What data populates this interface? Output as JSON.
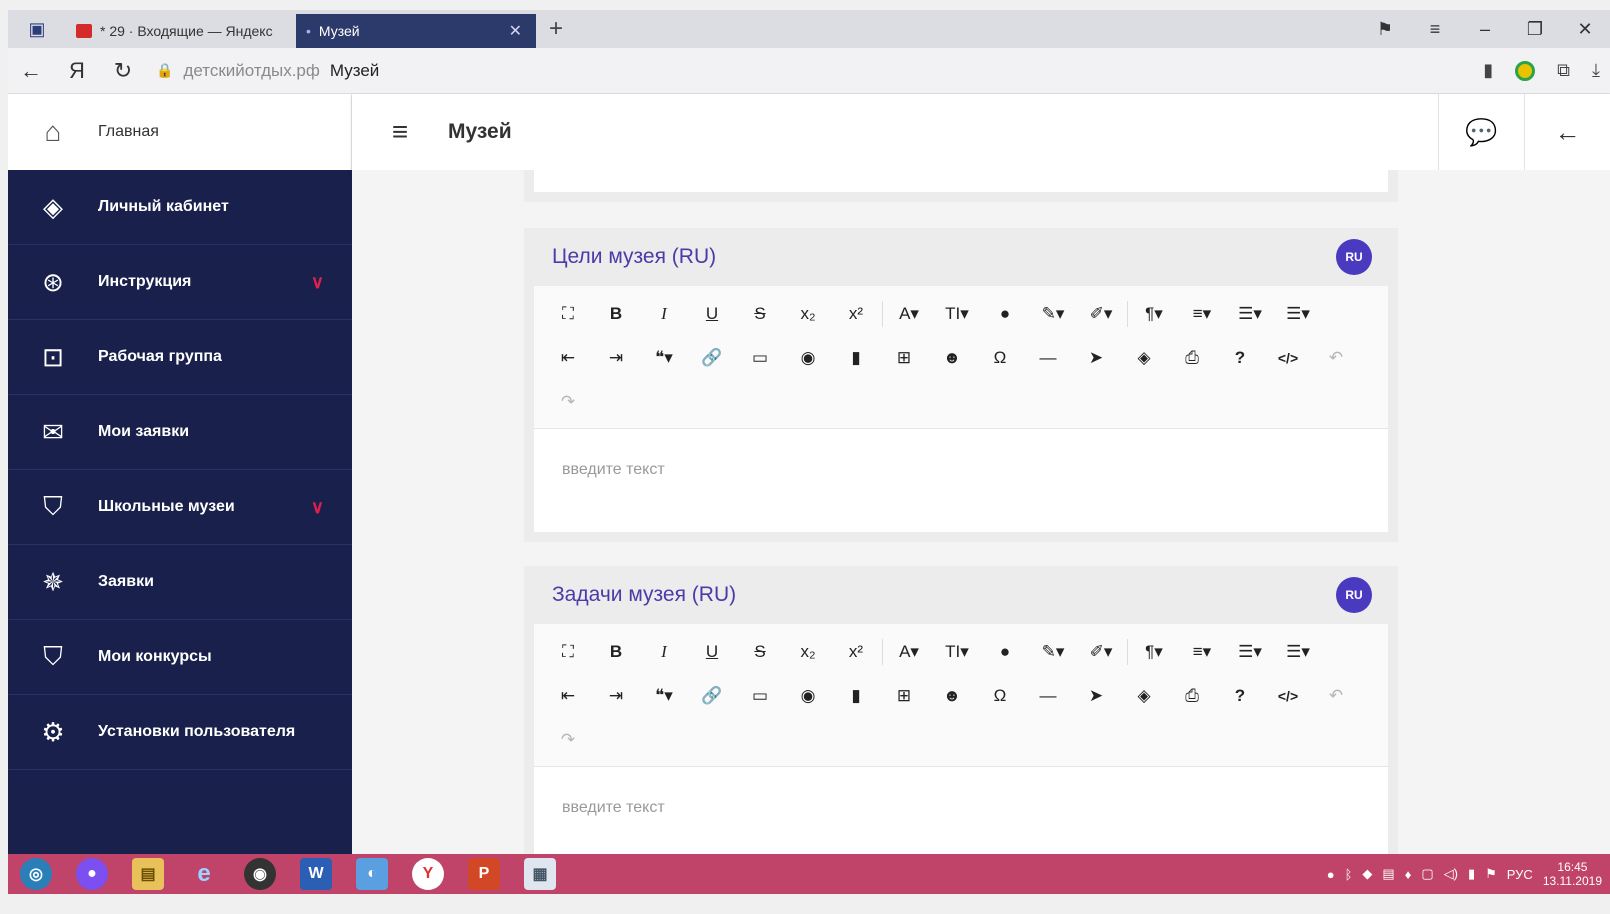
{
  "browser": {
    "tabs": [
      {
        "label": "* 29 · Входящие — Яндекс",
        "active": false
      },
      {
        "label": "Музей",
        "active": true
      }
    ],
    "new_tab": "+",
    "window_controls": [
      "minimize-icon",
      "restore-icon",
      "close-icon"
    ],
    "address": {
      "host": "детскийотдых.рф",
      "path": "Музей"
    }
  },
  "sidebar": {
    "home_label": "Главная",
    "items": [
      {
        "label": "Личный кабинет",
        "icon": "layers-icon",
        "expandable": false
      },
      {
        "label": "Инструкция",
        "icon": "lifebuoy-icon",
        "expandable": true
      },
      {
        "label": "Рабочая группа",
        "icon": "user-badge-icon",
        "expandable": false
      },
      {
        "label": "Мои заявки",
        "icon": "mail-edit-icon",
        "expandable": false
      },
      {
        "label": "Школьные музеи",
        "icon": "museum-badge-icon",
        "expandable": true
      },
      {
        "label": "Заявки",
        "icon": "star-burst-icon",
        "expandable": false
      },
      {
        "label": "Мои конкурсы",
        "icon": "contest-badge-icon",
        "expandable": false
      },
      {
        "label": "Установки пользователя",
        "icon": "gears-icon",
        "expandable": false
      }
    ]
  },
  "header": {
    "title": "Музей"
  },
  "cards": [
    {
      "title": "Цели музея (RU)",
      "lang": "RU",
      "placeholder": "введите текст"
    },
    {
      "title": "Задачи музея (RU)",
      "lang": "RU",
      "placeholder": "введите текст"
    }
  ],
  "toolbar": {
    "row1": [
      "⛶",
      "B",
      "I",
      "U",
      "S",
      "x₂",
      "x²",
      "A▾",
      "TI▾",
      "●",
      "✎▾",
      "✐▾",
      "¶▾",
      "≡▾",
      "☰▾",
      "☰▾"
    ],
    "row2": [
      "⇤",
      "⇥",
      "❝▾",
      "🔗",
      "▭",
      "◉",
      "▮",
      "⊞",
      "☻",
      "Ω",
      "—",
      "➤",
      "◈",
      "⎙",
      "?",
      "</>",
      "↶"
    ],
    "row3": [
      "↷"
    ]
  },
  "taskbar": {
    "apps": [
      "start",
      "chrome-like",
      "explorer",
      "ie",
      "media",
      "word",
      "sound",
      "yandex",
      "powerpoint",
      "files"
    ],
    "lang": "РУС",
    "time": "16:45",
    "date": "13.11.2019"
  },
  "colors": {
    "sidebar_bg": "#18204b",
    "accent_purple": "#4d3aa8",
    "chevron_red": "#e0204c",
    "taskbar": "#c0436a"
  }
}
